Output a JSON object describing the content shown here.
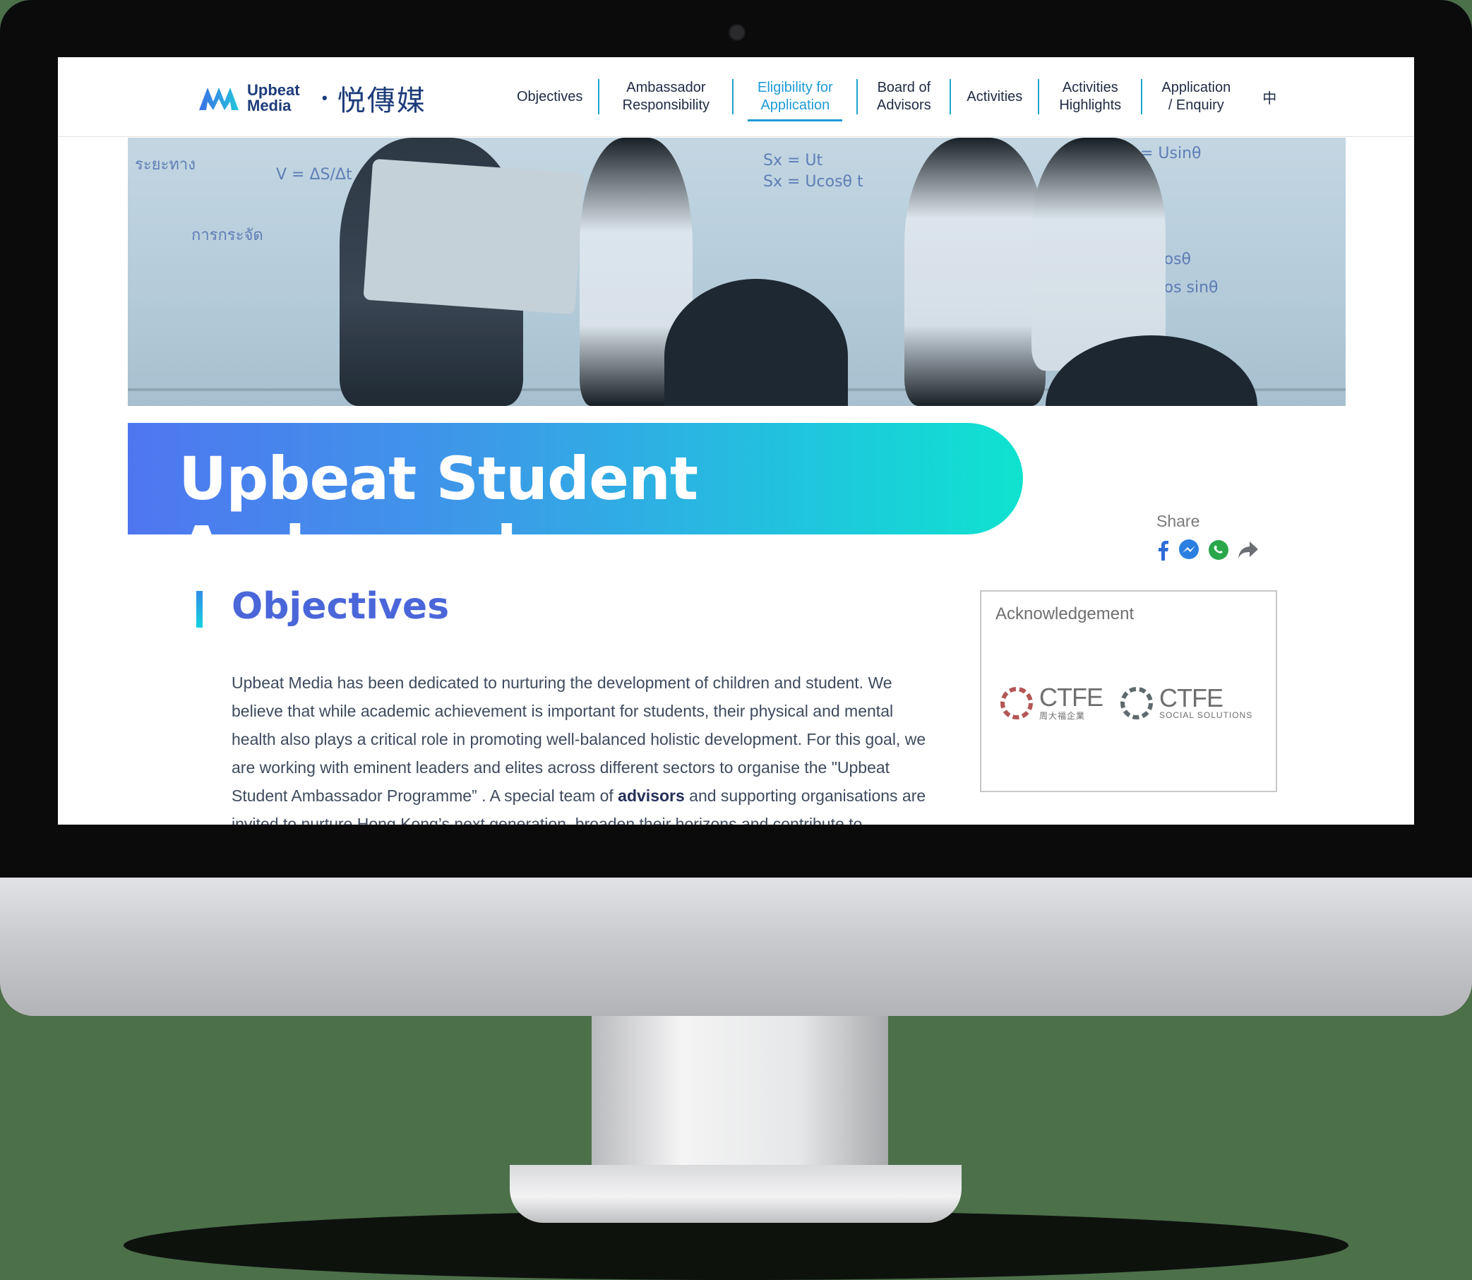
{
  "brand": {
    "name_en": "Upbeat Media",
    "separator": "•",
    "name_zh": "悦傳媒"
  },
  "nav": {
    "items": [
      {
        "label": "Objectives"
      },
      {
        "label": "Ambassador Responsibility"
      },
      {
        "label": "Eligibility for Application",
        "active": true
      },
      {
        "label": "Board of Advisors"
      },
      {
        "label": "Activities"
      },
      {
        "label": "Activities Highlights"
      },
      {
        "label": "Application / Enquiry"
      }
    ],
    "lang_toggle": "中"
  },
  "hero": {
    "title": "Upbeat Student Ambassador"
  },
  "share": {
    "label": "Share",
    "icons": [
      "facebook-icon",
      "messenger-icon",
      "whatsapp-icon",
      "share-arrow-icon"
    ]
  },
  "objectives": {
    "heading": "Objectives",
    "para_part1": "Upbeat Media has been dedicated to nurturing the development of children and student. We believe that while academic achievement is important for students, their physical and mental health also plays a critical role in promoting well-balanced holistic development. For this goal, we are working with eminent leaders and elites across different sectors to organise the \"Upbeat Student Ambassador Programme”  . A special team of ",
    "para_bold": "advisors",
    "para_part2": " and supporting organisations are invited to nurture Hong Kong’s next generation, broaden their horizons and contribute to"
  },
  "acknowledgement": {
    "title": "Acknowledgement",
    "logos": [
      {
        "name": "CTFE",
        "sub": "周大福企業"
      },
      {
        "name": "CTFE",
        "sub": "SOCIAL SOLUTIONS"
      }
    ]
  },
  "colors": {
    "accent": "#1f9ad7",
    "heading": "#4a66d9",
    "banner_start": "#4f76f0",
    "banner_end": "#0fe3cf"
  }
}
